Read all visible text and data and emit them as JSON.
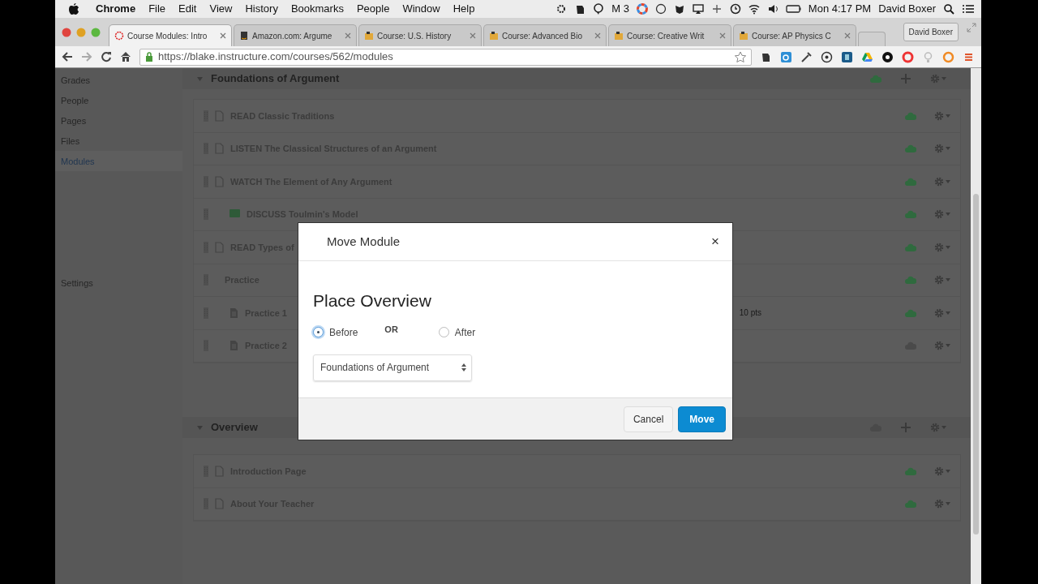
{
  "menubar": {
    "app": "Chrome",
    "menus": [
      "File",
      "Edit",
      "View",
      "History",
      "Bookmarks",
      "People",
      "Window",
      "Help"
    ],
    "mail_badge": "M 3",
    "clock": "Mon 4:17 PM",
    "user": "David Boxer"
  },
  "tabs": [
    {
      "title": "Course Modules: Intro",
      "selected": true,
      "kind": "canvas"
    },
    {
      "title": "Amazon.com: Argume",
      "selected": false,
      "kind": "amazon"
    },
    {
      "title": "Course: U.S. History",
      "selected": false,
      "kind": "course"
    },
    {
      "title": "Course: Advanced Bio",
      "selected": false,
      "kind": "course"
    },
    {
      "title": "Course: Creative Writ",
      "selected": false,
      "kind": "course"
    },
    {
      "title": "Course: AP Physics C",
      "selected": false,
      "kind": "course"
    }
  ],
  "profile": "David Boxer",
  "address": "https://blake.instructure.com/courses/562/modules",
  "sidebar": {
    "items": [
      {
        "label": "Grades",
        "selected": false
      },
      {
        "label": "People",
        "selected": false
      },
      {
        "label": "Pages",
        "selected": false
      },
      {
        "label": "Files",
        "selected": false
      },
      {
        "label": "Modules",
        "selected": true
      },
      {
        "label": "Settings",
        "selected": false
      }
    ]
  },
  "modules": [
    {
      "title": "Foundations of Argument",
      "published": true,
      "items": [
        {
          "title": "READ Classic Traditions",
          "kind": "page",
          "indented": false,
          "published": true
        },
        {
          "title": "LISTEN The Classical Structures of an Argument",
          "kind": "page",
          "indented": false,
          "published": true
        },
        {
          "title": "WATCH The Element of Any Argument",
          "kind": "page",
          "indented": false,
          "published": true
        },
        {
          "title": "DISCUSS Toulmin's Model",
          "kind": "discussion",
          "indented": true,
          "published": true
        },
        {
          "title": "READ Types of",
          "kind": "page",
          "indented": false,
          "published": true
        },
        {
          "title": "Practice",
          "kind": "subheader",
          "indented": false,
          "published": true
        },
        {
          "title": "Practice 1",
          "kind": "assignment",
          "indented": true,
          "published": true,
          "points": "10 pts"
        },
        {
          "title": "Practice 2",
          "kind": "assignment",
          "indented": true,
          "published": false
        }
      ]
    },
    {
      "title": "Overview",
      "published": false,
      "items": [
        {
          "title": "Introduction Page",
          "kind": "page",
          "indented": false,
          "published": true
        },
        {
          "title": "About Your Teacher",
          "kind": "page",
          "indented": false,
          "published": true
        }
      ]
    }
  ],
  "modal": {
    "title": "Move Module",
    "close": "×",
    "heading": "Place Overview",
    "options": [
      {
        "label": "Before",
        "selected": true
      },
      {
        "label": "After",
        "selected": false
      }
    ],
    "separator": "OR",
    "select": "Foundations of Argument",
    "buttons": [
      {
        "label": "Cancel",
        "kind": "secondary"
      },
      {
        "label": "Move",
        "kind": "primary"
      }
    ]
  }
}
